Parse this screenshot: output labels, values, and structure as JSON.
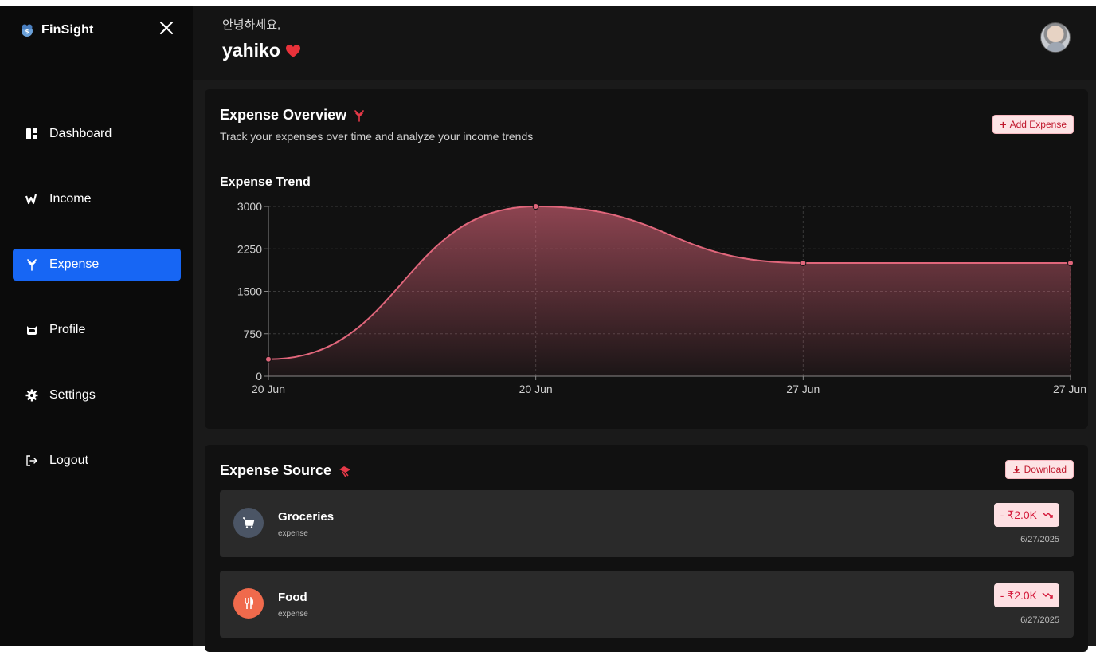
{
  "app": {
    "name": "FinSight",
    "accent": "#1766f4",
    "expense_color": "#e0667b"
  },
  "sidebar": {
    "items": [
      {
        "label": "Dashboard",
        "icon": "dashboard-icon",
        "active": false
      },
      {
        "label": "Income",
        "icon": "income-icon",
        "active": false
      },
      {
        "label": "Expense",
        "icon": "expense-icon",
        "active": true
      },
      {
        "label": "Profile",
        "icon": "profile-icon",
        "active": false
      },
      {
        "label": "Settings",
        "icon": "gear-icon",
        "active": false
      },
      {
        "label": "Logout",
        "icon": "logout-icon",
        "active": false
      }
    ]
  },
  "header": {
    "greeting": "안녕하세요,",
    "username": "yahiko"
  },
  "overview": {
    "title": "Expense Overview",
    "subtitle": "Track your expenses over time and analyze your income trends",
    "add_button": "Add Expense"
  },
  "chart_data": {
    "type": "area",
    "title": "Expense Trend",
    "x": [
      "20 Jun",
      "20 Jun",
      "27 Jun",
      "27 Jun"
    ],
    "values": [
      300,
      3000,
      2000,
      2000
    ],
    "ylim": [
      0,
      3000
    ],
    "yticks": [
      0,
      750,
      1500,
      2250,
      3000
    ],
    "grid": true
  },
  "source": {
    "title": "Expense Source",
    "download_button": "Download",
    "items": [
      {
        "name": "Groceries",
        "type": "expense",
        "amount": "- ₹2.0K",
        "date": "6/27/2025",
        "icon": "cart-icon",
        "icon_bg": "#4b5565"
      },
      {
        "name": "Food",
        "type": "expense",
        "amount": "- ₹2.0K",
        "date": "6/27/2025",
        "icon": "cutlery-icon",
        "icon_bg": "#f06a4c"
      }
    ]
  }
}
